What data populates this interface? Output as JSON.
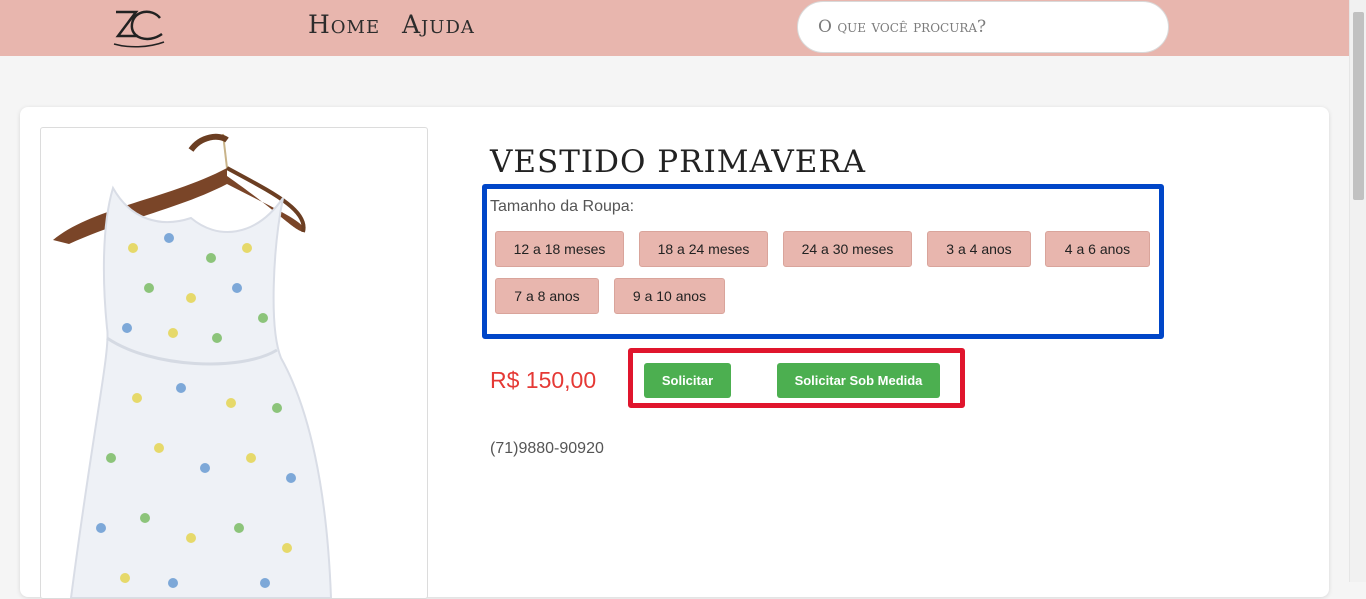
{
  "header": {
    "logo_text": "ZC",
    "nav": [
      {
        "label": "Home"
      },
      {
        "label": "Ajuda"
      }
    ],
    "search_placeholder": "O que você procura?"
  },
  "product": {
    "title": "VESTIDO PRIMAVERA",
    "size_label": "Tamanho da Roupa:",
    "sizes": [
      "12 a 18 meses",
      "18 a 24 meses",
      "24 a 30 meses",
      "3 a 4 anos",
      "4 a 6 anos",
      "7 a 8 anos",
      "9 a 10 anos"
    ],
    "price": "R$ 150,00",
    "request_label": "Solicitar",
    "custom_request_label": "Solicitar Sob Medida",
    "phone": "(71)9880-90920"
  },
  "colors": {
    "header_bg": "#e8b6ae",
    "size_button_bg": "#e8b6ae",
    "action_button_bg": "#4caf50",
    "price": "#e53935",
    "highlight_blue": "#0046c8",
    "highlight_red": "#e0152d"
  }
}
